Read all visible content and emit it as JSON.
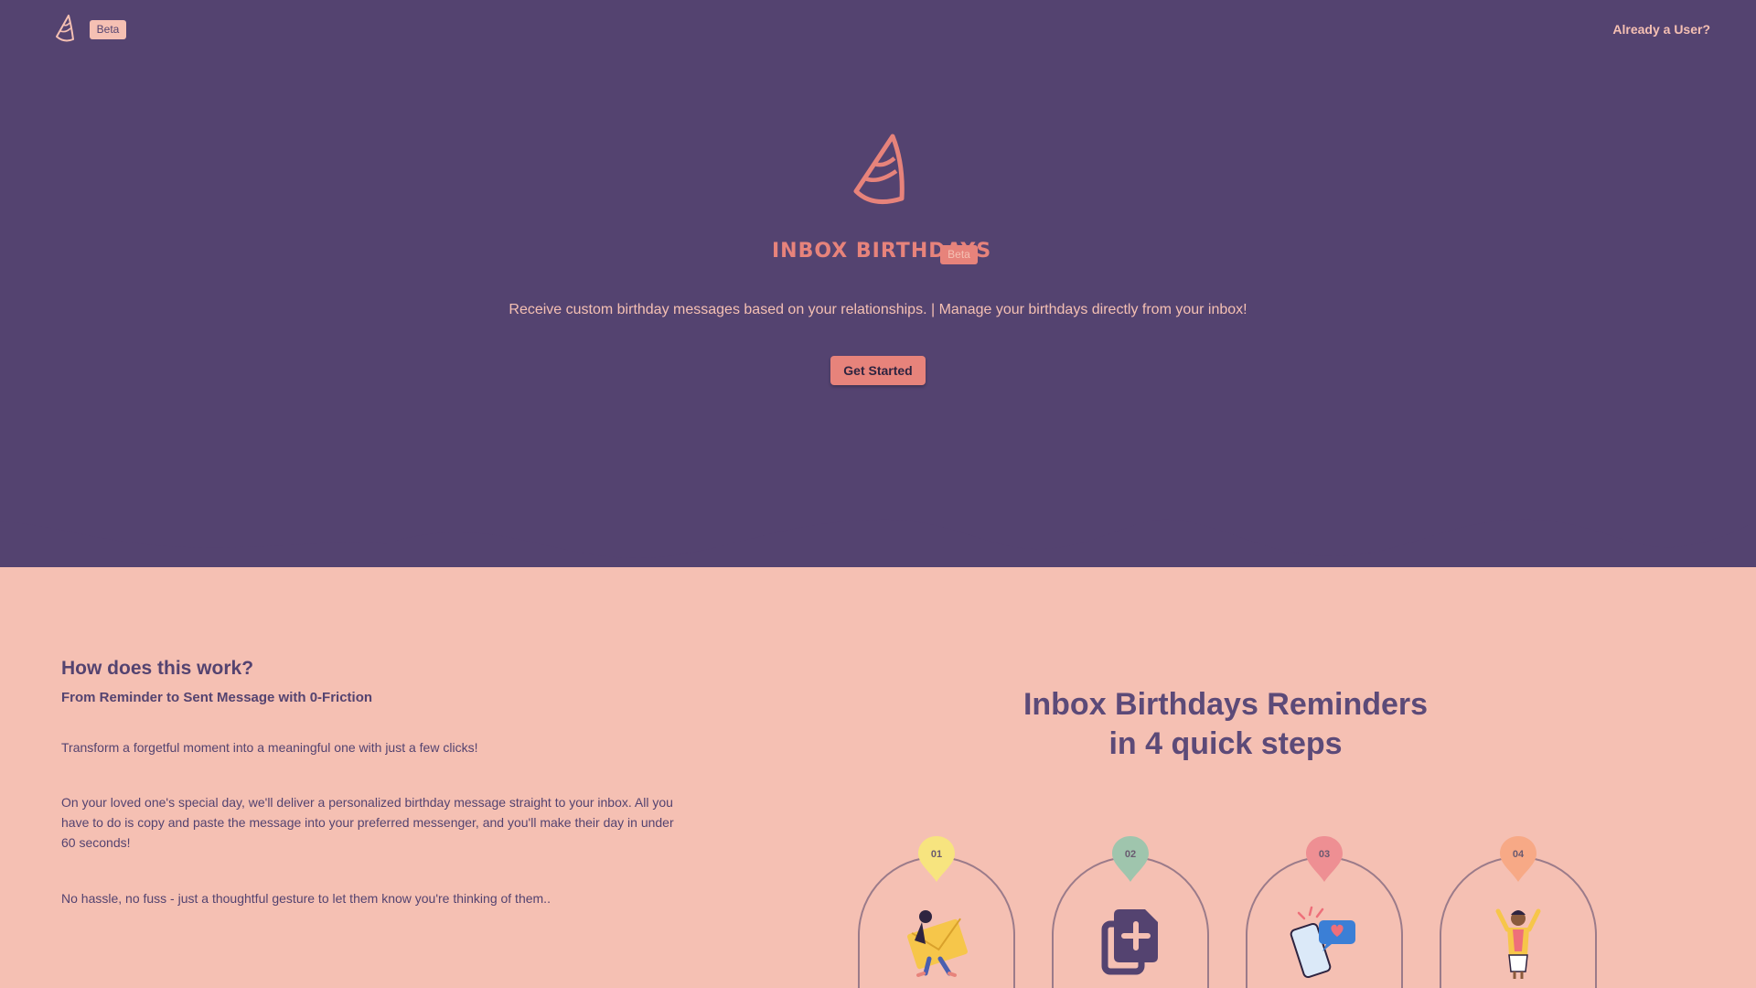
{
  "colors": {
    "hero_background": "#544370",
    "page_background": "#f5c0b3",
    "accent": "#e7837b",
    "heading_text": "#544370",
    "step_pins": [
      "#f7e47f",
      "#9fc5ad",
      "#ee8f93",
      "#f7a986"
    ]
  },
  "header": {
    "logo_icon": "party-hat-icon",
    "beta_label": "Beta",
    "login_link": "Already a User?"
  },
  "hero": {
    "logo_icon": "party-hat-icon",
    "brand": "INBOX BIRTHDAYS",
    "beta_label": "Beta",
    "tagline": "Receive custom birthday messages based on your relationships. | Manage your birthdays directly from your inbox!",
    "cta_label": "Get Started"
  },
  "how": {
    "title": "How does this work?",
    "subtitle": "From Reminder to Sent Message with 0-Friction",
    "paragraphs": [
      "Transform a forgetful moment into a meaningful one with just a few clicks!",
      "On your loved one's special day, we'll deliver a personalized birthday message straight to your inbox. All you have to do is copy and paste the message into your preferred messenger, and you'll make their day in under 60 seconds!",
      "No hassle, no fuss - just a thoughtful gesture to let them know you're thinking of them.."
    ]
  },
  "steps": {
    "title_line1": "Inbox Birthdays Reminders",
    "title_line2": "in 4 quick steps",
    "items": [
      {
        "number": "01",
        "icon": "person-with-envelope-icon"
      },
      {
        "number": "02",
        "icon": "copy-add-icon"
      },
      {
        "number": "03",
        "icon": "phone-heart-message-icon"
      },
      {
        "number": "04",
        "icon": "celebrating-person-icon"
      }
    ]
  }
}
